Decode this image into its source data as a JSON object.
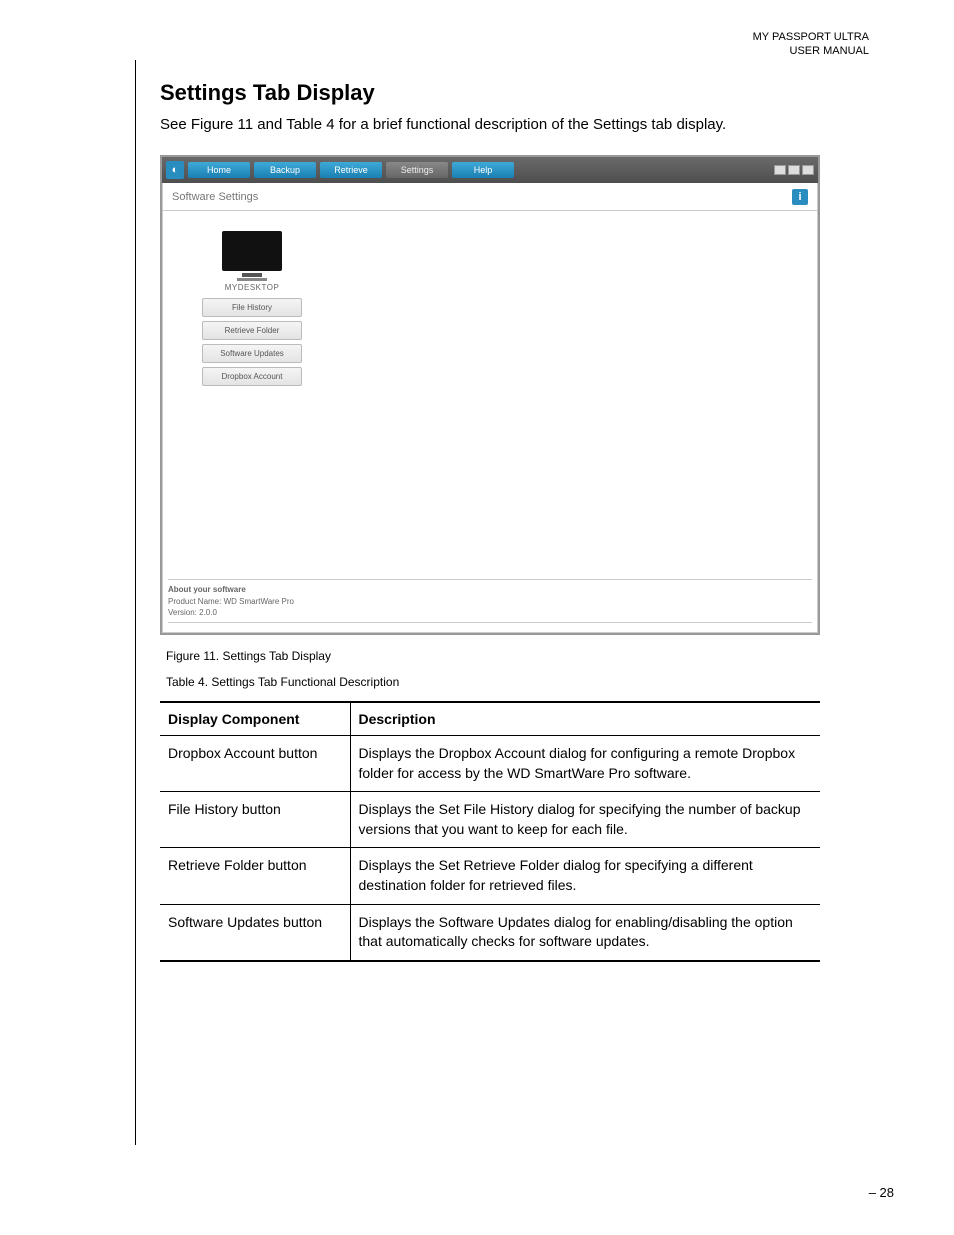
{
  "header": {
    "line1": "MY PASSPORT ULTRA",
    "line2": "USER MANUAL"
  },
  "section_title": "Settings Tab Display",
  "intro_text": "See Figure 11 and Table 4 for a brief functional description of the Settings tab display.",
  "app": {
    "tabs": {
      "home": "Home",
      "backup": "Backup",
      "retrieve": "Retrieve",
      "settings": "Settings",
      "help": "Help"
    },
    "subheader": "Software Settings",
    "device_name": "MYDESKTOP",
    "buttons": {
      "file_history": "File History",
      "retrieve_folder": "Retrieve Folder",
      "software_updates": "Software Updates",
      "dropbox_account": "Dropbox Account"
    },
    "about": {
      "title": "About your software",
      "product": "Product Name: WD SmartWare Pro",
      "version": "Version: 2.0.0"
    }
  },
  "figure_caption": "Figure 11.  Settings Tab Display",
  "table_caption": "Table 4.  Settings Tab Functional Description",
  "table": {
    "col1": "Display Component",
    "col2": "Description",
    "rows": [
      {
        "component": "Dropbox Account button",
        "description": "Displays the Dropbox Account dialog for configuring a remote Dropbox folder for access by the WD SmartWare Pro software."
      },
      {
        "component": "File History button",
        "description": "Displays the Set File History dialog for specifying the number of backup versions that you want to keep for each file."
      },
      {
        "component": "Retrieve Folder button",
        "description": "Displays the Set Retrieve Folder dialog for specifying a different destination folder for retrieved files."
      },
      {
        "component": "Software Updates button",
        "description": "Displays the Software Updates dialog for enabling/disabling the option that automatically checks for software updates."
      }
    ]
  },
  "page_number": "– 28"
}
